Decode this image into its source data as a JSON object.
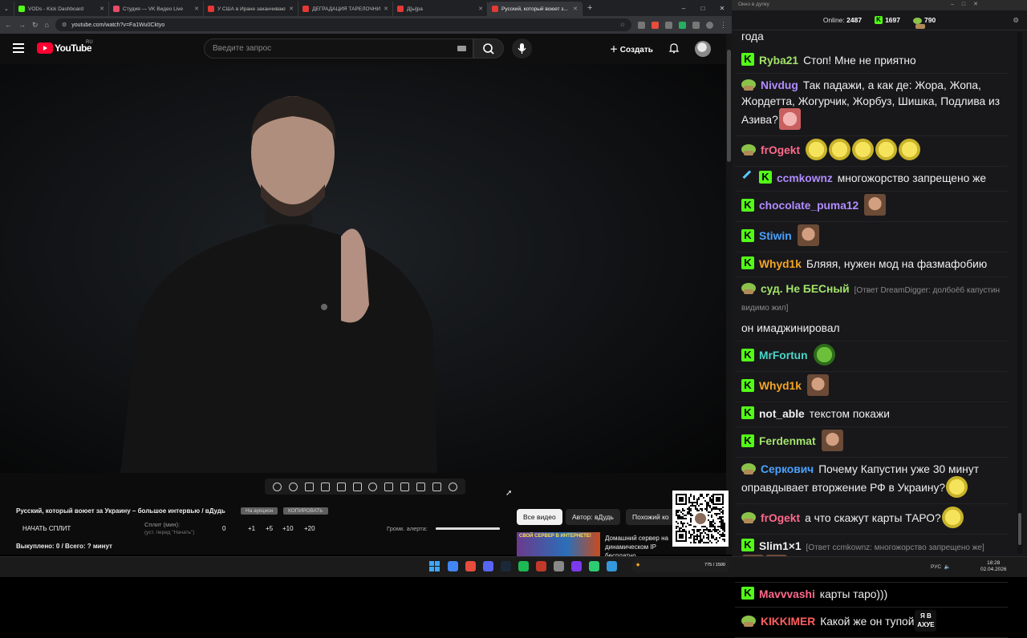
{
  "browser": {
    "tabs": [
      {
        "title": "VODs - Kick Dashboard",
        "fav": "#53fc18"
      },
      {
        "title": "Студия — VK Видео Live",
        "fav": "#e84b6a"
      },
      {
        "title": "У США в Иране заканчиваются",
        "fav": "#e53935"
      },
      {
        "title": "ДЕГРАДАЦИЯ ТАРЕЛОЧНИЦ",
        "fav": "#e53935"
      },
      {
        "title": "Д[ы]ра",
        "fav": "#e53935"
      },
      {
        "title": "Русский, который воюет з...",
        "fav": "#e53935",
        "active": true
      }
    ],
    "new_tab": "+",
    "url": "youtube.com/watch?v=Fa1Wu0Cktyo"
  },
  "youtube": {
    "logo_text": "YouTube",
    "region": "RU",
    "search_placeholder": "Введите запрос",
    "create_label": "Создать"
  },
  "player_toolbar": {
    "icons": [
      "loop-icon",
      "broadcast-icon",
      "cast-icon",
      "clapper-icon",
      "pip-icon",
      "frames-icon",
      "speed-icon",
      "add-icon",
      "keyboard-icon",
      "camera-icon",
      "flask-icon",
      "gear-icon"
    ]
  },
  "panel": {
    "video_title": "Русский, который воюет за Украину – большое интервью / вДудь",
    "tag1": "На аукцион",
    "tag2": "КОПИРОВАТЬ",
    "split_button": "НАЧАТЬ СПЛИТ",
    "split_label": "Сплит (мин):",
    "split_hint": "(уст. перед \"Начать\")",
    "split_value": "0",
    "increments": [
      "+1",
      "+5",
      "+10",
      "+20"
    ],
    "bought": "Выкуплено: 0 / Всего: ? минут",
    "volume_label": "Громк. алерта:",
    "volume_level": 1.0
  },
  "filters": [
    "Все видео",
    "Автор: вДудь",
    "Похожий ко"
  ],
  "recommended": {
    "thumb_text": "СВОЙ СЕРВЕР В ИНТЕРНЕТЕ!",
    "title": "Домашний сервер на динамическом IP бесплатно..."
  },
  "chat": {
    "window_title": "Окно в дупку",
    "online_label": "Online:",
    "online_count": "2487",
    "kick_count": "1697",
    "pepe_count": "790",
    "messages": [
      {
        "user": "",
        "color": "#efefef",
        "badge": "",
        "text": "года"
      },
      {
        "user": "Ryba21",
        "color": "#a3e36a",
        "badge": "k",
        "text": "Стоп! Мне не приятно"
      },
      {
        "user": "Nivdug",
        "color": "#b18cff",
        "badge": "pepe",
        "text": "Так падажи, а как де: Жора, Жопа, Жордетта, Жогурчик, Жорбуз, Шишка, Подлива из Азива?",
        "emotes": [
          "e-pink"
        ]
      },
      {
        "user": "frOgekt",
        "color": "#ff6a8a",
        "badge": "pepe",
        "text": "",
        "emotes": [
          "e-lol",
          "e-lol",
          "e-lol",
          "e-lol",
          "e-lol"
        ]
      },
      {
        "user": "ccmkownz",
        "color": "#b18cff",
        "badge": "sword-k",
        "text": "многожорство запрещено же"
      },
      {
        "user": "chocolate_puma12",
        "color": "#b18cff",
        "badge": "k",
        "text": "",
        "emotes": [
          "e-face"
        ]
      },
      {
        "user": "Stiwin",
        "color": "#4aa3ff",
        "badge": "k",
        "text": "",
        "emotes": [
          "e-face"
        ]
      },
      {
        "user": "Whyd1k",
        "color": "#f5a623",
        "badge": "k",
        "text": "Бляяя, нужен мод на фазмафобию"
      },
      {
        "user": "суд. Не БЕСный",
        "color": "#a3e36a",
        "badge": "pepe",
        "reply": "[Ответ DreamDigger: долбоёб капустин видимо жил]",
        "text": ""
      },
      {
        "user": "",
        "color": "#efefef",
        "badge": "",
        "text": "он имаджинировал"
      },
      {
        "user": "MrFortun",
        "color": "#4ad6c8",
        "badge": "k",
        "text": "",
        "emotes": [
          "e-pepe"
        ]
      },
      {
        "user": "Whyd1k",
        "color": "#f5a623",
        "badge": "k",
        "text": "",
        "emotes": [
          "e-face"
        ]
      },
      {
        "user": "not_able",
        "color": "#efefef",
        "badge": "k",
        "text": "текстом покажи"
      },
      {
        "user": "Ferdenmat",
        "color": "#a3e36a",
        "badge": "k",
        "text": "",
        "emotes": [
          "e-face"
        ]
      },
      {
        "user": "Серкович",
        "color": "#4aa3ff",
        "badge": "pepe",
        "text": "Почему Капустин уже 30 минут оправдывает вторжение РФ в Украину?",
        "emotes": [
          "e-lol"
        ]
      },
      {
        "user": "frOgekt",
        "color": "#ff6a8a",
        "badge": "pepe",
        "text": "а что скажут карты ТАРО?",
        "emotes": [
          "e-lol"
        ]
      },
      {
        "user": "Slim1×1",
        "color": "#efefef",
        "badge": "k",
        "reply": "[Ответ ccmkownz: многожорство запрещено же]",
        "text": "",
        "emotes": [
          "e-face",
          "e-face"
        ]
      },
      {
        "user": "Mavvvashi",
        "color": "#ff6a8a",
        "badge": "k",
        "text": "карты таро)))"
      },
      {
        "user": "KIKKIMER",
        "color": "#ff5e5e",
        "badge": "pepe",
        "text": "Какой же он тупой",
        "emote_text": "Я В АХУЕ"
      }
    ]
  },
  "taskbar": {
    "lang": "РУС",
    "time": "18:28",
    "date": "02.04.2026",
    "game_text": "775 / 1500"
  }
}
